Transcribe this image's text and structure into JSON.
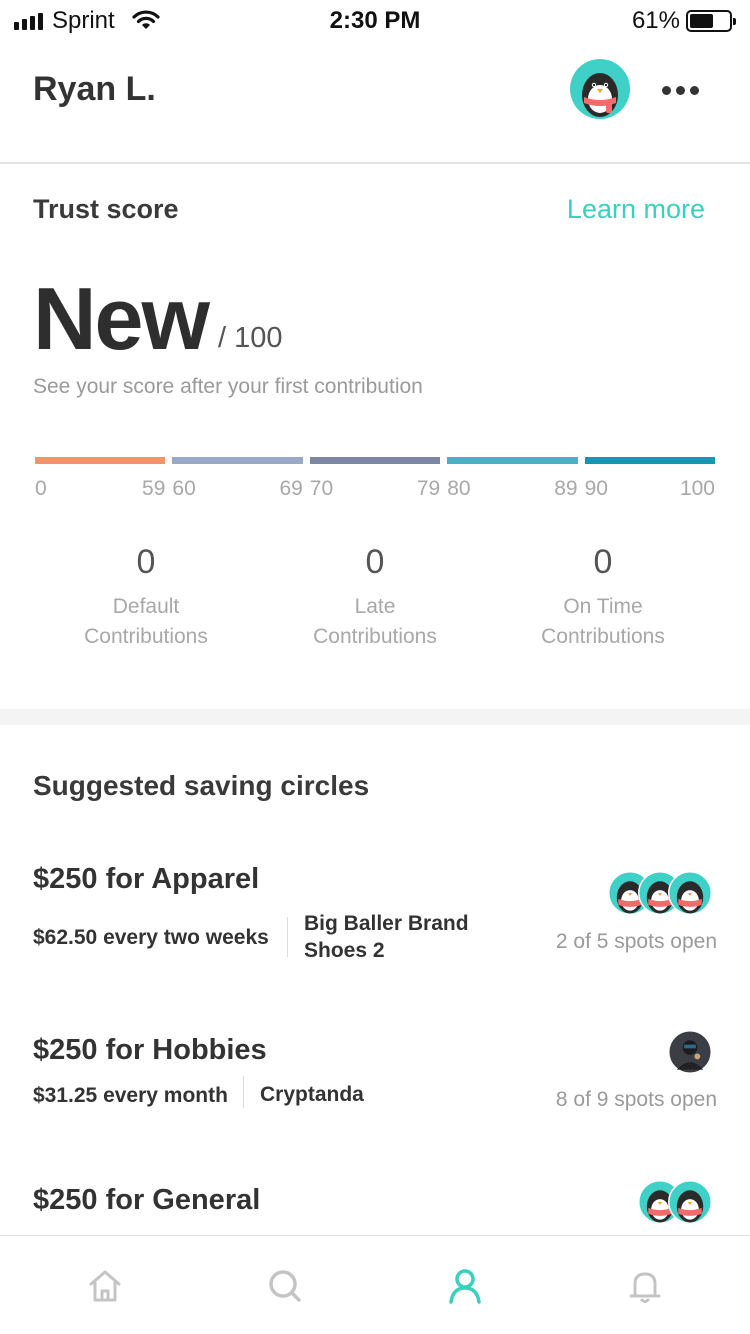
{
  "status_bar": {
    "carrier": "Sprint",
    "time": "2:30 PM",
    "battery": "61%",
    "battery_level": 0.61
  },
  "header": {
    "name": "Ryan L."
  },
  "trust": {
    "title": "Trust score",
    "learn_more": "Learn more",
    "score": "New",
    "max": "/ 100",
    "subtitle": "See your score after your first contribution",
    "scale": [
      {
        "start": "0",
        "end": "59",
        "color": "#f0956a"
      },
      {
        "start": "60",
        "end": "69",
        "color": "#9aa8c7"
      },
      {
        "start": "70",
        "end": "79",
        "color": "#7d87a3"
      },
      {
        "start": "80",
        "end": "89",
        "color": "#4fadc6"
      },
      {
        "start": "90",
        "end": "100",
        "color": "#1b93b3"
      }
    ],
    "stats": [
      {
        "value": "0",
        "label": "Default Contributions"
      },
      {
        "value": "0",
        "label": "Late Contributions"
      },
      {
        "value": "0",
        "label": "On Time Contributions"
      }
    ]
  },
  "suggested": {
    "title": "Suggested saving circles",
    "circles": [
      {
        "title": "$250 for Apparel",
        "frequency": "$62.50 every two weeks",
        "item": "Big Baller Brand Shoes 2",
        "spots": "2 of 5 spots open"
      },
      {
        "title": "$250 for Hobbies",
        "frequency": "$31.25 every month",
        "item": "Cryptanda",
        "spots": "8 of 9 spots open"
      },
      {
        "title": "$250 for General"
      }
    ]
  },
  "tabs": [
    {
      "icon": "home-icon",
      "active": false
    },
    {
      "icon": "search-icon",
      "active": false
    },
    {
      "icon": "profile-icon",
      "active": true
    },
    {
      "icon": "bell-icon",
      "active": false
    }
  ],
  "colors": {
    "accent": "#3ad0c0",
    "text": "#333333",
    "muted": "#9a9a9a"
  }
}
